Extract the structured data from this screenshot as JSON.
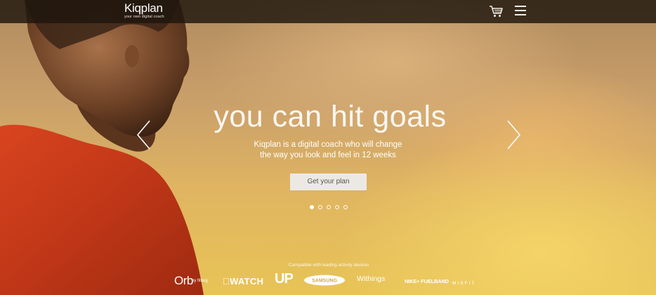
{
  "header": {
    "logo_name": "Kiqplan",
    "logo_tagline": "your own digital coach",
    "cart_icon": "cart-icon",
    "menu_icon": "hamburger-menu-icon"
  },
  "hero": {
    "headline_light": "you can ",
    "headline_bold": "hit goals",
    "subhead_line1": "Kiqplan is a digital coach who will change",
    "subhead_line2": "the way you look and feel in 12 weeks",
    "cta_label": "Get your plan",
    "prev_icon": "chevron-left-icon",
    "next_icon": "chevron-right-icon",
    "slide_count": 5,
    "active_slide": 1
  },
  "compat": {
    "label": "Compatible with leading activity devices",
    "brands": {
      "orb": "Orb",
      "orb_sub": "by fitbug",
      "watch": "WATCH",
      "up": "UP",
      "samsung": "SAMSUNG",
      "withings": "Withings",
      "nike": "NIKE+ FUELBAND",
      "misfit": "MISFIT"
    }
  },
  "colors": {
    "shirt": "#c8361c",
    "sky_warm": "#e8c456",
    "topbar": "#1e160e"
  }
}
